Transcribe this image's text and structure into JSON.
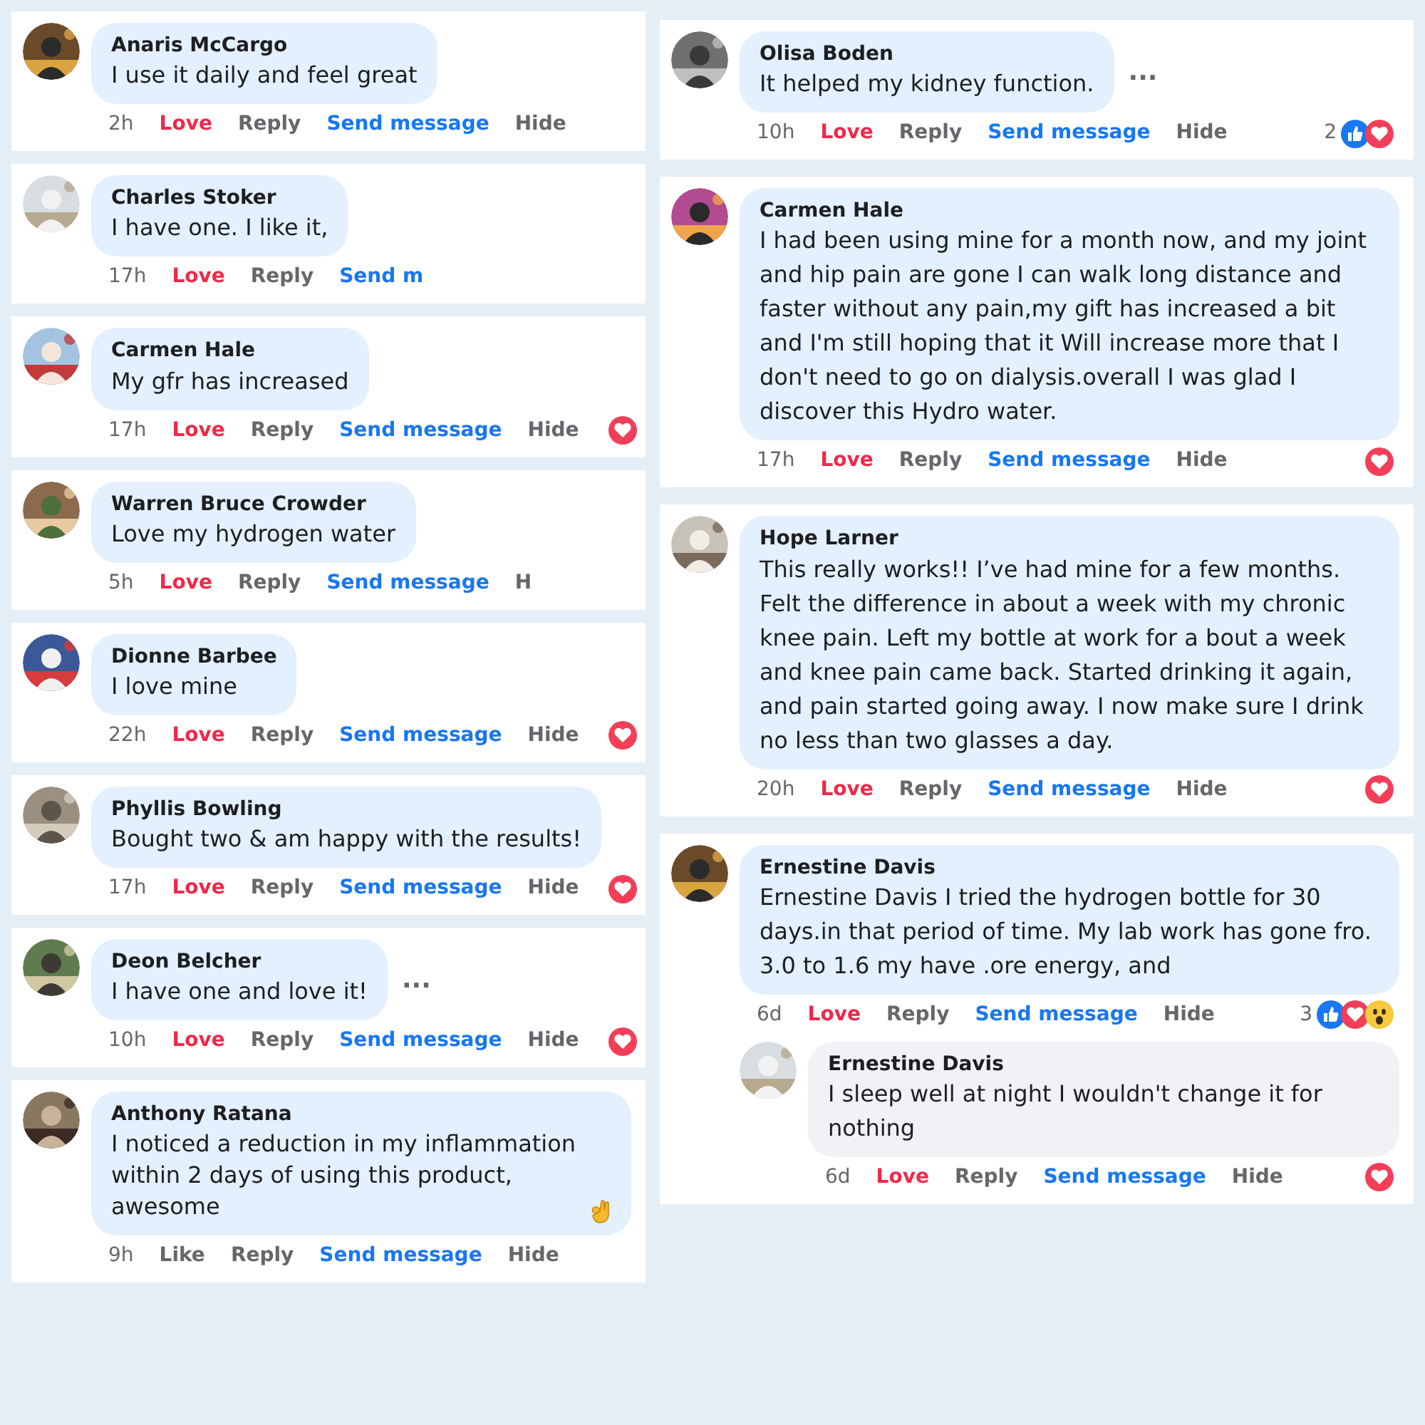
{
  "columns": [
    {
      "comments": [
        {
          "name": "Anaris McCargo",
          "text": "I use it daily and feel great",
          "actions": [
            {
              "kind": "time",
              "label": "2h"
            },
            {
              "kind": "love",
              "label": "Love"
            },
            {
              "kind": "reply",
              "label": "Reply"
            },
            {
              "kind": "send",
              "label": "Send message"
            },
            {
              "kind": "hide",
              "label": "Hide"
            }
          ]
        },
        {
          "name": "Charles Stoker",
          "text": "I have one. I like it,",
          "actions": [
            {
              "kind": "time",
              "label": "17h"
            },
            {
              "kind": "love",
              "label": "Love"
            },
            {
              "kind": "reply",
              "label": "Reply"
            },
            {
              "kind": "send",
              "label": "Send m"
            }
          ]
        },
        {
          "name": "Carmen Hale",
          "text": "My gfr has increased",
          "actions": [
            {
              "kind": "time",
              "label": "17h"
            },
            {
              "kind": "love",
              "label": "Love"
            },
            {
              "kind": "reply",
              "label": "Reply"
            },
            {
              "kind": "send",
              "label": "Send message"
            },
            {
              "kind": "hide",
              "label": "Hide"
            }
          ],
          "reactions": {
            "love": true
          }
        },
        {
          "name": "Warren Bruce Crowder",
          "text": "Love my hydrogen water",
          "actions": [
            {
              "kind": "time",
              "label": "5h"
            },
            {
              "kind": "love",
              "label": "Love"
            },
            {
              "kind": "reply",
              "label": "Reply"
            },
            {
              "kind": "send",
              "label": "Send message"
            },
            {
              "kind": "hide",
              "label": "H"
            }
          ]
        },
        {
          "name": "Dionne Barbee",
          "text": "I love mine",
          "actions": [
            {
              "kind": "time",
              "label": "22h"
            },
            {
              "kind": "love",
              "label": "Love"
            },
            {
              "kind": "reply",
              "label": "Reply"
            },
            {
              "kind": "send",
              "label": "Send message"
            },
            {
              "kind": "hide",
              "label": "Hide"
            }
          ],
          "reactions": {
            "love": true
          }
        },
        {
          "name": "Phyllis Bowling",
          "text": "Bought two & am happy with the results!",
          "actions": [
            {
              "kind": "time",
              "label": "17h"
            },
            {
              "kind": "love",
              "label": "Love"
            },
            {
              "kind": "reply",
              "label": "Reply"
            },
            {
              "kind": "send",
              "label": "Send message"
            },
            {
              "kind": "hide",
              "label": "Hide"
            }
          ],
          "reactions": {
            "love": true
          }
        },
        {
          "name": "Deon Belcher",
          "text": "I have one and love it!",
          "more": "...",
          "actions": [
            {
              "kind": "time",
              "label": "10h"
            },
            {
              "kind": "love",
              "label": "Love"
            },
            {
              "kind": "reply",
              "label": "Reply"
            },
            {
              "kind": "send",
              "label": "Send message"
            },
            {
              "kind": "hide",
              "label": "Hide"
            }
          ],
          "reactions": {
            "love": true
          }
        },
        {
          "name": "Anthony Ratana",
          "text": "I noticed a reduction in my inflammation within 2 days of using this product, awesome",
          "ok_hand_emoji": true,
          "actions": [
            {
              "kind": "time",
              "label": "9h"
            },
            {
              "kind": "like",
              "label": "Like"
            },
            {
              "kind": "reply",
              "label": "Reply"
            },
            {
              "kind": "send",
              "label": "Send message"
            },
            {
              "kind": "hide",
              "label": "Hide"
            }
          ]
        }
      ]
    },
    {
      "comments": [
        {
          "name": "Olisa Boden",
          "text": "It helped my kidney function.",
          "more": "...",
          "actions": [
            {
              "kind": "time",
              "label": "10h"
            },
            {
              "kind": "love",
              "label": "Love"
            },
            {
              "kind": "reply",
              "label": "Reply"
            },
            {
              "kind": "send",
              "label": "Send message"
            },
            {
              "kind": "hide",
              "label": "Hide"
            }
          ],
          "reactions": {
            "count": "2",
            "like": true,
            "love": true
          }
        },
        {
          "name": "Carmen Hale",
          "text": "I had been using mine for a month now, and my joint and hip pain are gone I can walk long distance and faster without any pain,my gift has increased a bit and I'm still hoping that it Will increase more that I don't need to go on dialysis.overall I was glad I discover this Hydro water.",
          "actions": [
            {
              "kind": "time",
              "label": "17h"
            },
            {
              "kind": "love",
              "label": "Love"
            },
            {
              "kind": "reply",
              "label": "Reply"
            },
            {
              "kind": "send",
              "label": "Send message"
            },
            {
              "kind": "hide",
              "label": "Hide"
            }
          ],
          "reactions": {
            "love": true
          }
        },
        {
          "name": "Hope Larner",
          "text": "This really works!! I’ve had mine for a few months. Felt the difference in about a week with my chronic knee pain. Left my bottle at work for a bout a week and knee pain came back. Started drinking it again, and pain started going away. I now make sure I drink no less than two glasses a day.",
          "actions": [
            {
              "kind": "time",
              "label": "20h"
            },
            {
              "kind": "love",
              "label": "Love"
            },
            {
              "kind": "reply",
              "label": "Reply"
            },
            {
              "kind": "send",
              "label": "Send message"
            },
            {
              "kind": "hide",
              "label": "Hide"
            }
          ],
          "reactions": {
            "love": true
          }
        },
        {
          "name": "Ernestine Davis",
          "text": "Ernestine Davis I tried the hydrogen bottle for 30 days.in that period of time. My lab work has gone fro. 3.0 to 1.6 my have .ore energy, and",
          "actions": [
            {
              "kind": "time",
              "label": "6d"
            },
            {
              "kind": "love",
              "label": "Love"
            },
            {
              "kind": "reply",
              "label": "Reply"
            },
            {
              "kind": "send",
              "label": "Send message"
            },
            {
              "kind": "hide",
              "label": "Hide"
            }
          ],
          "reactions": {
            "count": "3",
            "like": true,
            "love": true,
            "wow": true
          },
          "replies": [
            {
              "name": "Ernestine Davis",
              "text": "I sleep well at night I wouldn't change it for nothing",
              "actions": [
                {
                  "kind": "time",
                  "label": "6d"
                },
                {
                  "kind": "love",
                  "label": "Love"
                },
                {
                  "kind": "reply",
                  "label": "Reply"
                },
                {
                  "kind": "send",
                  "label": "Send message"
                },
                {
                  "kind": "hide",
                  "label": "Hide"
                }
              ],
              "reactions": {
                "love": true
              }
            }
          ]
        }
      ]
    }
  ]
}
